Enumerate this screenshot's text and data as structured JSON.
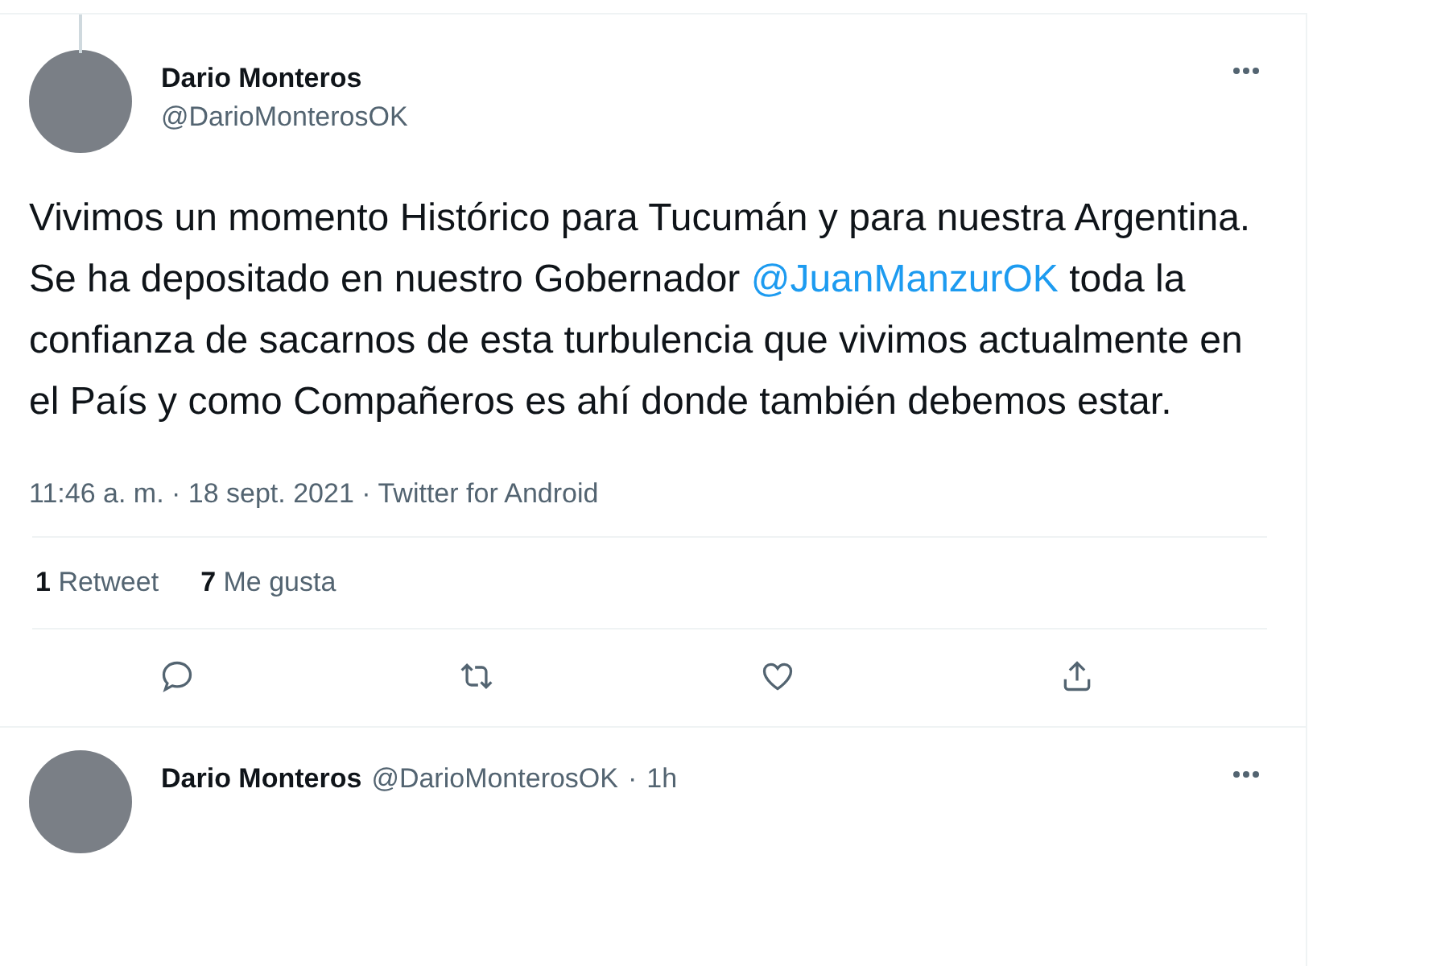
{
  "tweet": {
    "name": "Dario Monteros",
    "handle": "@DarioMonterosOK",
    "text_before": "Vivimos un momento Histórico para Tucumán y para nuestra Argentina. Se ha depositado en nuestro Gobernador ",
    "mention": "@JuanManzurOK",
    "text_after": " toda la confianza de sacarnos de esta turbulencia que vivimos actualmente en el País y como Compañeros es ahí donde también debemos estar.",
    "meta": "11:46 a. m. · 18 sept. 2021 · Twitter for Android",
    "stats": [
      {
        "count": "1",
        "label": "Retweet"
      },
      {
        "count": "7",
        "label": "Me gusta"
      }
    ]
  },
  "next_tweet": {
    "name": "Dario Monteros",
    "handle": "@DarioMonterosOK",
    "separator": "·",
    "time": "1h"
  }
}
